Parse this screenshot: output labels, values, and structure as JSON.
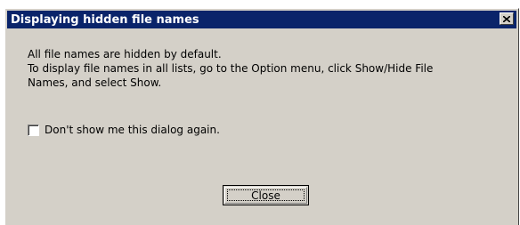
{
  "window": {
    "title": "Displaying hidden file names",
    "close_icon": "close-icon"
  },
  "message": {
    "line1": "All file names are hidden by default.",
    "line2": "To display file names in all lists, go to the Option menu, click Show/Hide File",
    "line3": "Names, and select Show."
  },
  "checkbox": {
    "label": "Don't show me this dialog again.",
    "checked": false
  },
  "buttons": {
    "close_label": "Close"
  },
  "colors": {
    "titlebar": "#0a246a",
    "dialog_face": "#d4d0c8"
  }
}
